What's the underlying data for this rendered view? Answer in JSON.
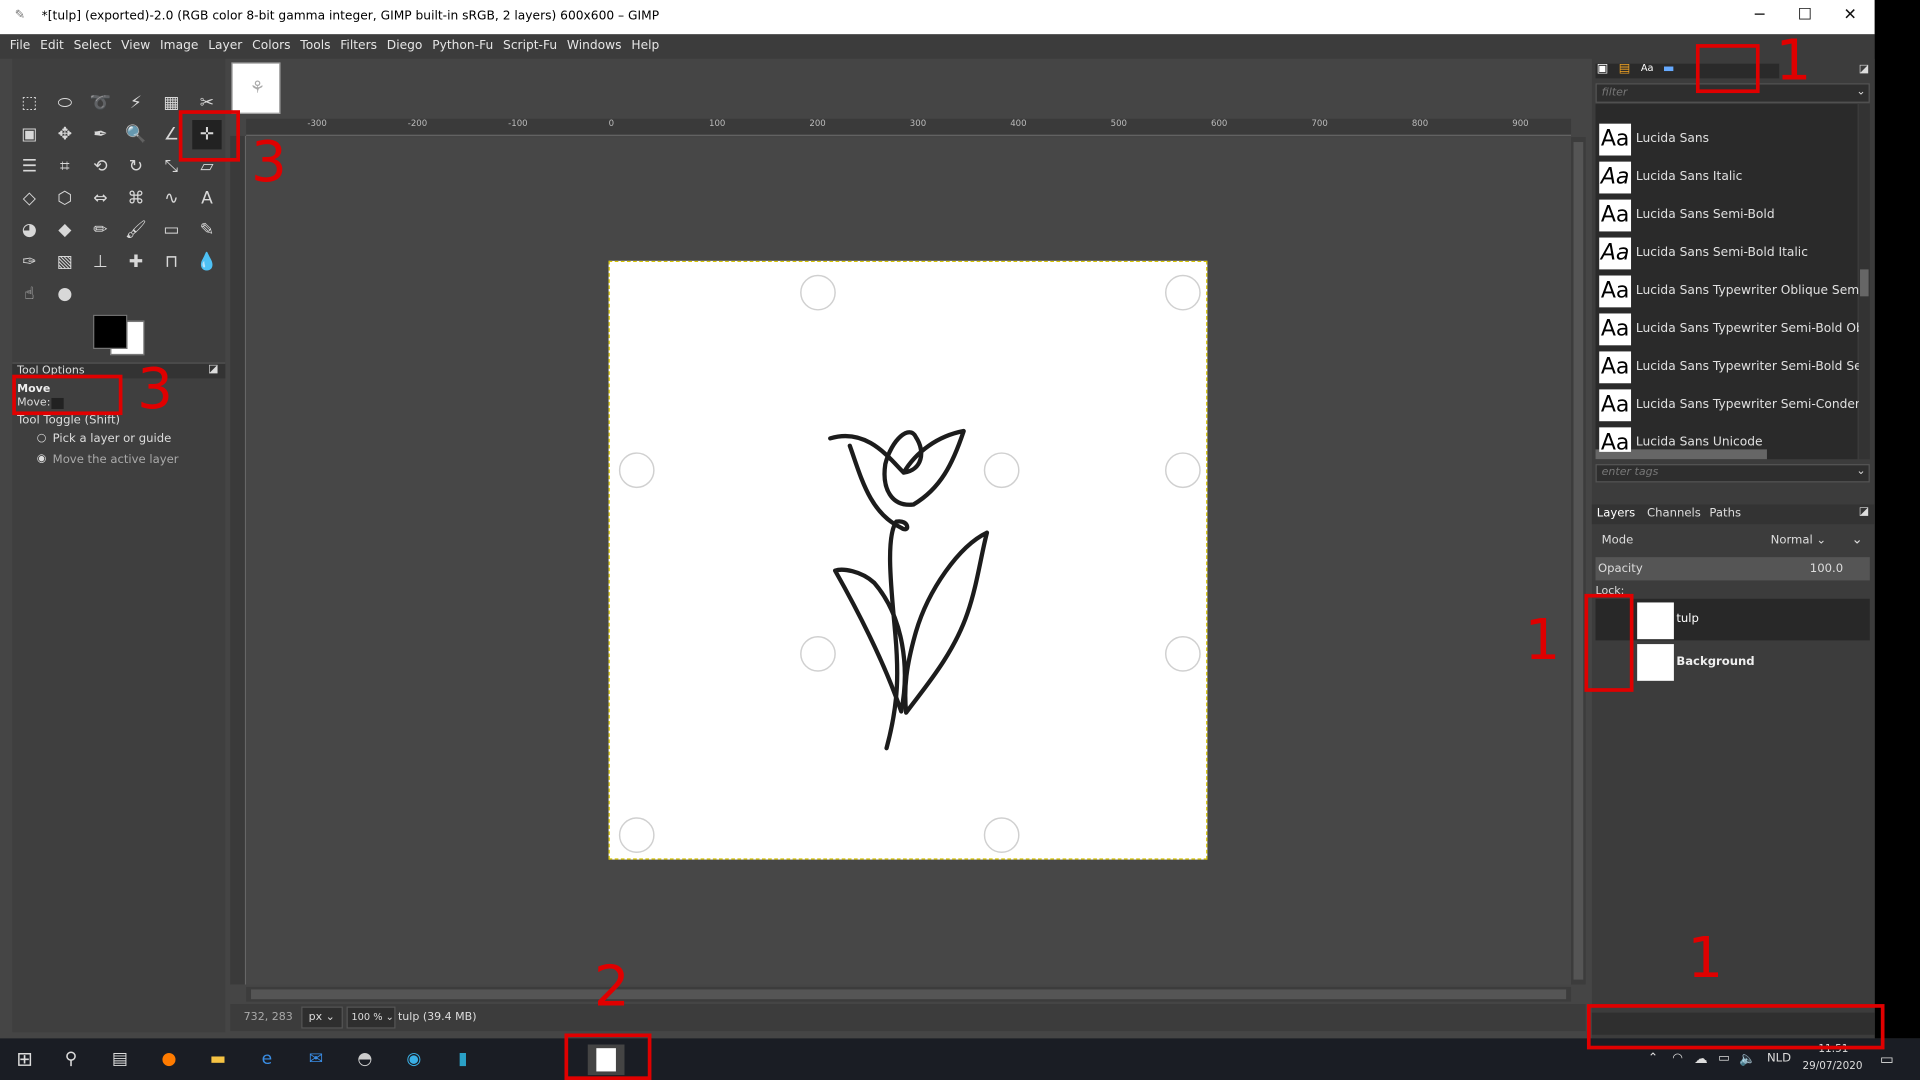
{
  "window": {
    "title": "*[tulp] (exported)-2.0 (RGB color 8-bit gamma integer, GIMP built-in sRGB, 2 layers) 600x600 – GIMP",
    "minimize": "─",
    "maximize": "☐",
    "close": "✕"
  },
  "menu": [
    "File",
    "Edit",
    "Select",
    "View",
    "Image",
    "Layer",
    "Colors",
    "Tools",
    "Filters",
    "Diego",
    "Python-Fu",
    "Script-Fu",
    "Windows",
    "Help"
  ],
  "tool_options": {
    "header": "Tool Options",
    "tool": "Move",
    "move_label": "Move:",
    "toggle_label": "Tool Toggle  (Shift)",
    "option1": "Pick a layer or guide",
    "option2": "Move the active layer"
  },
  "rulers": {
    "h": [
      "-300",
      "-200",
      "-100",
      "0",
      "100",
      "200",
      "300",
      "400",
      "500",
      "600",
      "700",
      "800",
      "900"
    ]
  },
  "status": {
    "coords": "732, 283",
    "unit": "px",
    "zoom": "100 %",
    "info": "tulp (39.4 MB)"
  },
  "fonts": {
    "filter_placeholder": "filter",
    "tags_placeholder": "enter tags",
    "list": [
      {
        "aa": "Aa",
        "name": "Lucida Sans",
        "italic": false
      },
      {
        "aa": "Aa",
        "name": "Lucida Sans Italic",
        "italic": true
      },
      {
        "aa": "Aa",
        "name": "Lucida Sans Semi-Bold",
        "italic": false
      },
      {
        "aa": "Aa",
        "name": "Lucida Sans Semi-Bold Italic",
        "italic": true
      },
      {
        "aa": "Aa",
        "name": "Lucida Sans Typewriter Oblique Semi-(",
        "italic": false
      },
      {
        "aa": "Aa",
        "name": "Lucida Sans Typewriter Semi-Bold Obl",
        "italic": false
      },
      {
        "aa": "Aa",
        "name": "Lucida Sans Typewriter Semi-Bold Ser",
        "italic": false
      },
      {
        "aa": "Aa",
        "name": "Lucida Sans Typewriter Semi-Condens",
        "italic": false
      },
      {
        "aa": "Aa",
        "name": "Lucida Sans Unicode",
        "italic": false
      }
    ]
  },
  "layers_panel": {
    "tabs": [
      "Layers",
      "Channels",
      "Paths"
    ],
    "mode_label": "Mode",
    "mode_value": "Normal",
    "opacity_label": "Opacity",
    "opacity_value": "100.0",
    "lock_label": "Lock:",
    "layers": [
      "tulp",
      "Background"
    ]
  },
  "taskbar": {
    "lang": "NLD",
    "time": "11:51",
    "date": "29/07/2020"
  },
  "annotations": {
    "one": "1",
    "two": "2",
    "three": "3"
  },
  "colors": {
    "annotation": "#e00000",
    "selection_border": "#d7c400"
  }
}
